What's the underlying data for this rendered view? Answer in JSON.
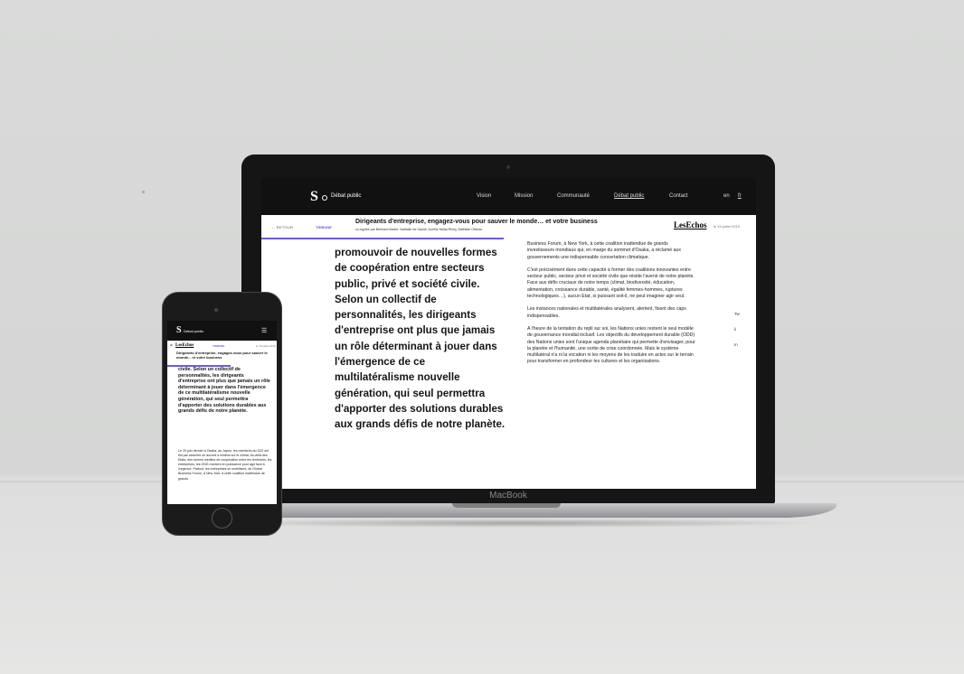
{
  "laptop": {
    "brand_label": "MacBook",
    "nav": {
      "logo": "S",
      "site_section": "Débat public",
      "items": [
        "Vision",
        "Mission",
        "Communauté",
        "Débat public",
        "Contact"
      ],
      "lang_en": "en",
      "lang_fr": "fr"
    },
    "article_header": {
      "back": "← RETOUR",
      "tag": "TRIBUNE",
      "title": "Dirigeants d'entreprise, engagez-vous pour sauver le monde… et votre business",
      "signed": "co-signée par Bertrand Badré, Nathalie de Gaulle, Aurélie Motta-Rivey, Mathilde Oliveau",
      "source": "LesEchos",
      "date": "le 15 juillet 2019",
      "progress": 0.49
    },
    "quote": "promouvoir de nouvelles formes de coopération entre secteurs public, privé et société civile. Selon un collectif de personnalités, les dirigeants d'entreprise ont plus que jamais un rôle déterminant à jouer dans l'émergence de ce multilatéralisme nouvelle génération, qui seul permettra d'apporter des solutions durables aux grands défis de notre planète.",
    "paragraphs": [
      "Business Forum, à New York, à cette coalition inattendue de grands investisseurs mondiaux qui, en marge du sommet d'Osaka, a réclamé aux gouvernements une indispensable concertation climatique.",
      "C'est précisément dans cette capacité à former des coalitions innovantes entre secteur public, secteur privé et société civile que réside l'avenir de notre planète. Face aux défis cruciaux de notre temps (climat, biodiversité, éducation, alimentation, croissance durable, santé, égalité femmes-hommes, ruptures technologiques…), aucun Etat, si puissant soit-il, ne peut imaginer agir seul.",
      "Les instances nationales et multilatérales analysent, alertent, fixent des caps indispensables.",
      "A l'heure de la tentation du repli sur soi, les Nations unies restent le seul modèle de gouvernance mondial inclusif. Les objectifs du développement durable (ODD) des Nations unies sont l'unique agenda planétaire qui permette d'envisager, pour la planète et l'humanité, une sortie de crise coordonnée. Mais le système multilatéral n'a ni la vocation ni les moyens de les traduire en actes sur le terrain pour transformer en profondeur les cultures et les organisations."
    ],
    "share": [
      "Tw",
      "li",
      "In"
    ]
  },
  "phone": {
    "nav": {
      "logo": "S",
      "site_section": "Débat public",
      "menu_icon": "menu-icon"
    },
    "header": {
      "close": "×",
      "source": "LesEchos",
      "tag": "TRIBUNE",
      "date": "le 15 juillet 2019",
      "title": "Dirigeants d'entreprise, engagez-vous pour sauver le monde... et votre business",
      "progress": 0.58
    },
    "quote": "civile. Selon un collectif de personnalités, les dirigeants d'entreprise ont plus que jamais un rôle déterminant à jouer dans l'émergence de ce multilatéralisme nouvelle génération, qui seul permettra d'apporter des solutions durables aux grands défis de notre planète.",
    "body": "Le 29 juin dernier à Osaka, au Japon, les membres du G20 ont fini par arracher un accord a minima sur le climat. Au-delà des Etats, des formes inédites de coopération entre les territoires, les entreprises, les ONG montent en puissance pour agir face à l'urgence. Partout, les entreprises se mobilisent, du Global Business Forum, à New York, à cette coalition inattendue de grands"
  },
  "colors": {
    "accent": "#6b5be0",
    "nav_bg": "#111111"
  }
}
